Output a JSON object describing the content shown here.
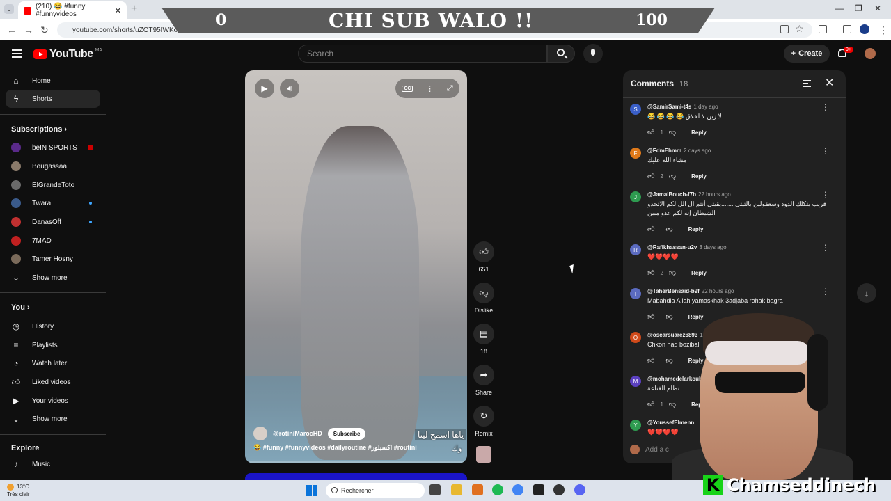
{
  "browser": {
    "tab_title": "(210) 😂 #funny #funnyvideos",
    "url": "youtube.com/shorts/uZOT95IWKok"
  },
  "banner": {
    "left_number": "0",
    "title": "CHI SUB WALO !!",
    "right_number": "100"
  },
  "masthead": {
    "logo_text": "YouTube",
    "country_code": "MA",
    "search_placeholder": "Search",
    "create_label": "Create",
    "notifications_badge": "9+"
  },
  "sidebar": {
    "main": [
      {
        "label": "Home",
        "icon": "home-icon"
      },
      {
        "label": "Shorts",
        "icon": "shorts-icon",
        "active": true
      }
    ],
    "subscriptions_heading": "Subscriptions",
    "subscriptions": [
      {
        "label": "beIN SPORTS",
        "color": "#5a2a8a",
        "live": true
      },
      {
        "label": "Bougassaa",
        "color": "#8a7a6a"
      },
      {
        "label": "ElGrandeToto",
        "color": "#6a6a6a"
      },
      {
        "label": "Twara",
        "color": "#3a5a8a",
        "dot": true
      },
      {
        "label": "DanasOff",
        "color": "#c03030",
        "dot": true
      },
      {
        "label": "7MAD",
        "color": "#c02020"
      },
      {
        "label": "Tamer Hosny",
        "color": "#7a6a5a"
      }
    ],
    "subs_show_more": "Show more",
    "you_heading": "You",
    "you_items": [
      {
        "label": "History",
        "icon": "history-icon"
      },
      {
        "label": "Playlists",
        "icon": "playlists-icon"
      },
      {
        "label": "Watch later",
        "icon": "watch-later-icon"
      },
      {
        "label": "Liked videos",
        "icon": "thumbs-up-icon"
      },
      {
        "label": "Your videos",
        "icon": "your-videos-icon"
      }
    ],
    "you_show_more": "Show more",
    "explore_heading": "Explore",
    "explore_items": [
      {
        "label": "Music",
        "icon": "music-icon"
      }
    ]
  },
  "player": {
    "channel": "@rotiniMarocHD",
    "subscribe_label": "Subscribe",
    "tags": "😂 #funny #funnyvideos #dailyroutine #اكسبلور #routini",
    "overlay_text_1": "ياها اسمح لينا",
    "overlay_text_2": "وك",
    "progress": 0.0
  },
  "actions": {
    "like_count": "651",
    "dislike_label": "Dislike",
    "comment_count": "18",
    "share_label": "Share",
    "remix_label": "Remix"
  },
  "comments": {
    "title": "Comments",
    "count": "18",
    "add_placeholder": "Add a c",
    "reply_label": "Reply",
    "items": [
      {
        "initial": "S",
        "color": "#3a5fc8",
        "user": "@SamirSami-t4s",
        "time": "1 day ago",
        "text": "😂 😂 😂 😂 لا زين لا اخلاق",
        "likes": "1"
      },
      {
        "initial": "F",
        "color": "#e07a1a",
        "user": "@FdmEhmm",
        "time": "2 days ago",
        "text": "مشاء الله عليك",
        "likes": "2"
      },
      {
        "initial": "J",
        "color": "#2e9b50",
        "user": "@JamalBouch-f7b",
        "time": "22 hours ago",
        "text": "قريب يتكلك الدود وسعقولين بالتيتي .......يقيتي أنتم ال الل لكم الاتحدو الشيطان إنه لكم عدو مبين",
        "likes": ""
      },
      {
        "initial": "R",
        "color": "#5b6bc0",
        "user": "@Rafikhassan-u2v",
        "time": "3 days ago",
        "text": "❤️❤️❤️❤️",
        "likes": "2"
      },
      {
        "initial": "T",
        "color": "#5b6bc0",
        "user": "@TaherBensaid-b9f",
        "time": "22 hours ago",
        "text": "Mabahdla Allah yamaskhak 3adjaba rohak bagra",
        "likes": ""
      },
      {
        "initial": "O",
        "color": "#d04a1a",
        "user": "@oscarsuarez6893",
        "time": "1 day ago",
        "text": "Chkon had bozibal",
        "likes": ""
      },
      {
        "initial": "M",
        "color": "#5b40c0",
        "user": "@mohamedelarkoubi3342",
        "time": "",
        "text": "نظام القناعة",
        "likes": "1"
      },
      {
        "initial": "Y",
        "color": "#2e9b50",
        "user": "@YoussefElmenn",
        "time": "",
        "text": "❤️❤️❤️❤️",
        "likes": ""
      }
    ]
  },
  "streamer_brand": {
    "letter": "K",
    "name": "Chamseddinech"
  },
  "taskbar": {
    "temperature": "13°C",
    "weather": "Très clair",
    "search_label": "Rechercher"
  }
}
